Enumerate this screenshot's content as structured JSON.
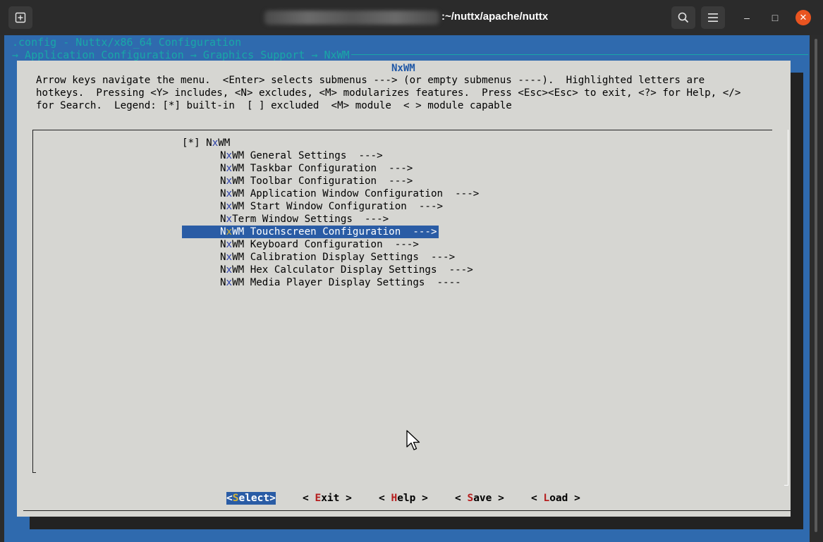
{
  "window": {
    "title": ":~/nuttx/apache/nuttx",
    "new_tab_icon": "plus-in-box-icon",
    "search_icon": "search-icon",
    "menu_icon": "hamburger-icon",
    "minimize": "–",
    "maximize": "□",
    "close": "✕"
  },
  "terminal": {
    "header_line1": ".config - Nuttx/x86_64 Configuration",
    "breadcrumb": "→ Application Configuration → Graphics Support → NxWM"
  },
  "dialog": {
    "title": "NxWM",
    "help_lines": [
      "Arrow keys navigate the menu.  <Enter> selects submenus ---> (or empty submenus ----).  Highlighted letters are",
      "hotkeys.  Pressing <Y> includes, <N> excludes, <M> modularizes features.  Press <Esc><Esc> to exit, <?> for Help, </>",
      "for Search.  Legend: [*] built-in  [ ] excluded  <M> module  < > module capable"
    ],
    "menu": [
      {
        "pre": "[*] N",
        "hk": "x",
        "post": "WM"
      },
      {
        "pre": "N",
        "hk": "x",
        "post": "WM General Settings  --->"
      },
      {
        "pre": "N",
        "hk": "x",
        "post": "WM Taskbar Configuration  --->"
      },
      {
        "pre": "N",
        "hk": "x",
        "post": "WM Toolbar Configuration  --->"
      },
      {
        "pre": "N",
        "hk": "x",
        "post": "WM Application Window Configuration  --->"
      },
      {
        "pre": "N",
        "hk": "x",
        "post": "WM Start Window Configuration  --->"
      },
      {
        "pre": "N",
        "hk": "x",
        "post": "Term Window Settings  --->"
      },
      {
        "pre": "N",
        "hk": "x",
        "post": "WM Touchscreen Configuration  --->",
        "selected": true
      },
      {
        "pre": "N",
        "hk": "x",
        "post": "WM Keyboard Configuration  --->"
      },
      {
        "pre": "N",
        "hk": "x",
        "post": "WM Calibration Display Settings  --->"
      },
      {
        "pre": "N",
        "hk": "x",
        "post": "WM Hex Calculator Display Settings  --->"
      },
      {
        "pre": "N",
        "hk": "x",
        "post": "WM Media Player Display Settings  ----"
      }
    ],
    "buttons": [
      {
        "pre": "<",
        "hk": "S",
        "post": "elect>",
        "selected": true
      },
      {
        "pre": "< ",
        "hk": "E",
        "post": "xit >"
      },
      {
        "pre": "< ",
        "hk": "H",
        "post": "elp >"
      },
      {
        "pre": "< ",
        "hk": "S",
        "post": "ave >"
      },
      {
        "pre": "< ",
        "hk": "L",
        "post": "oad >"
      }
    ]
  },
  "colors": {
    "terminal_bg": "#2f6aae",
    "dialog_bg": "#d6d6d2",
    "selection": "#2a5ca5",
    "hotkey": "#2a3fa8",
    "button_hotkey": "#b51d1d",
    "header_text": "#19a7a7"
  }
}
